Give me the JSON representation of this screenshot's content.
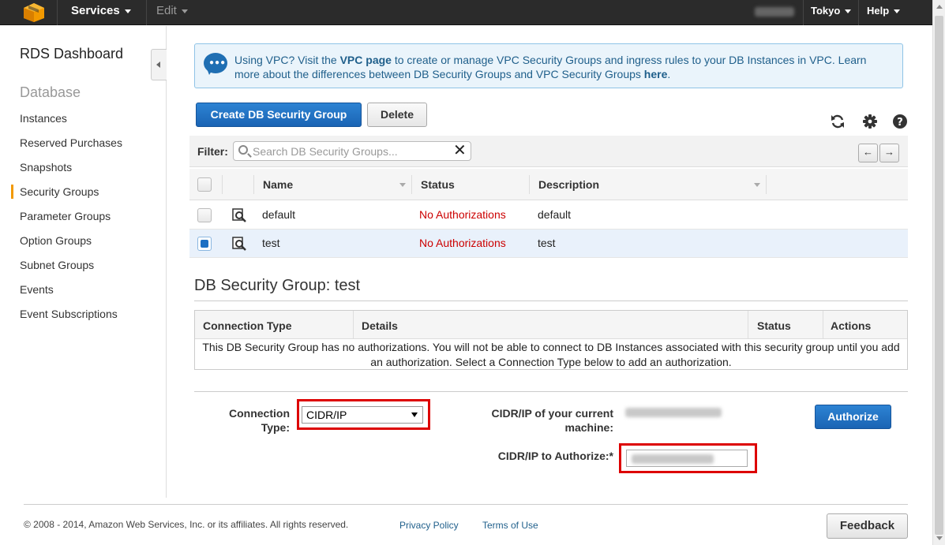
{
  "topnav": {
    "services_label": "Services",
    "edit_label": "Edit",
    "region_label": "Tokyo",
    "help_label": "Help"
  },
  "sidebar": {
    "title": "RDS Dashboard",
    "section_label": "Database",
    "items": [
      {
        "label": "Instances"
      },
      {
        "label": "Reserved Purchases"
      },
      {
        "label": "Snapshots"
      },
      {
        "label": "Security Groups"
      },
      {
        "label": "Parameter Groups"
      },
      {
        "label": "Option Groups"
      },
      {
        "label": "Subnet Groups"
      },
      {
        "label": "Events"
      },
      {
        "label": "Event Subscriptions"
      }
    ],
    "active_index": 3
  },
  "info": {
    "text_1": "Using VPC? Visit the",
    "vpc_link": "VPC page",
    "text_2": "to create or manage VPC Security Groups and ingress rules to your DB Instances in VPC. Learn more about the differences between DB Security Groups and VPC Security Groups",
    "here_link": "here",
    "text_3": "."
  },
  "toolbar": {
    "create_label": "Create DB Security Group",
    "delete_label": "Delete"
  },
  "filter": {
    "label": "Filter:",
    "placeholder": "Search DB Security Groups...",
    "clear_glyph": "✕",
    "prev_glyph": "←",
    "next_glyph": "→"
  },
  "table": {
    "headers": {
      "name": "Name",
      "status": "Status",
      "description": "Description"
    },
    "rows": [
      {
        "name": "default",
        "status": "No Authorizations",
        "description": "default",
        "selected": false
      },
      {
        "name": "test",
        "status": "No Authorizations",
        "description": "test",
        "selected": true
      }
    ]
  },
  "detail": {
    "title": "DB Security Group: test",
    "headers": {
      "connection_type": "Connection Type",
      "details": "Details",
      "status": "Status",
      "actions": "Actions"
    },
    "empty_message": "This DB Security Group has no authorizations. You will not be able to connect to DB Instances associated with this security group until you add an authorization. Select a Connection Type below to add an authorization."
  },
  "form": {
    "connection_type_label_1": "Connection",
    "connection_type_label_2": "Type:",
    "connection_type_value": "CIDR/IP",
    "current_ip_label_1": "CIDR/IP of your current",
    "current_ip_label_2": "machine:",
    "authorize_ip_label": "CIDR/IP to Authorize:*",
    "authorize_button": "Authorize"
  },
  "footer": {
    "copyright": "© 2008 - 2014, Amazon Web Services, Inc. or its affiliates. All rights reserved.",
    "privacy": "Privacy Policy",
    "terms": "Terms of Use",
    "feedback": "Feedback"
  },
  "colors": {
    "accent_orange": "#f29900",
    "primary_blue": "#1a64b4",
    "status_red": "#cc0000",
    "highlight_red": "#dd0000"
  }
}
